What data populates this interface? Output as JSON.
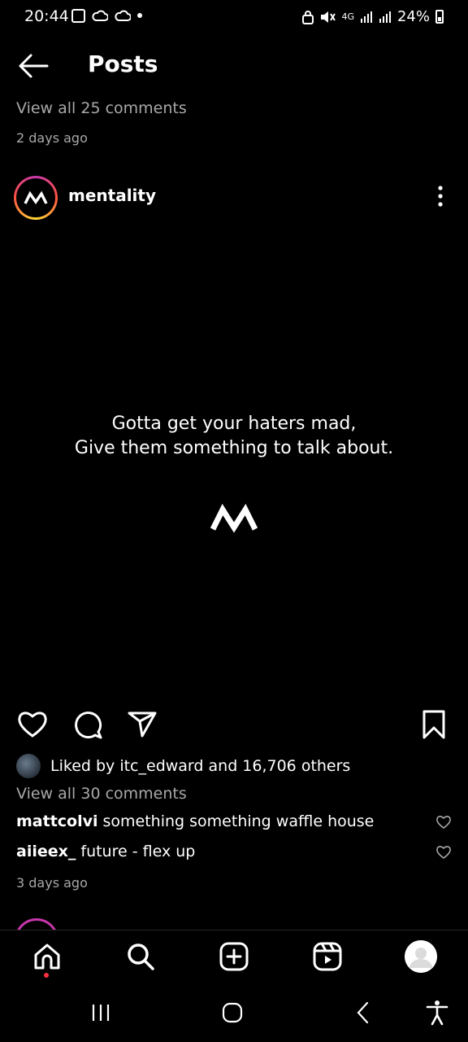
{
  "status_bar": {
    "time": "20:44",
    "network": "4G",
    "battery": "24%",
    "left_icons": [
      "gallery-icon",
      "cloud-icon",
      "cloud-icon",
      "dot-icon"
    ],
    "right_icons": [
      "lock-icon",
      "mute-icon",
      "signal-icon",
      "signal-icon",
      "battery-icon"
    ]
  },
  "header": {
    "title": "Posts"
  },
  "previous_post": {
    "view_comments": "View all 25 comments",
    "date": "2 days ago"
  },
  "post": {
    "username": "mentality",
    "quote_line_1": "Gotta get your haters mad,",
    "quote_line_2": "Give them something to talk about.",
    "likes_text": "Liked by itc_edward and 16,706 others",
    "view_comments": "View all 30 comments",
    "comments": [
      {
        "user": "mattcolvi",
        "text": "something something waffle house"
      },
      {
        "user": "aiieex_",
        "text": "future - flex up"
      }
    ],
    "date": "3 days ago"
  },
  "colors": {
    "background": "#000000",
    "secondary_text": "#a8a8a8",
    "notification_dot": "#ff3040",
    "story_ring": "#c837ab"
  },
  "bottom_nav": [
    "home-icon",
    "search-icon",
    "create-icon",
    "reels-icon",
    "profile-avatar"
  ]
}
